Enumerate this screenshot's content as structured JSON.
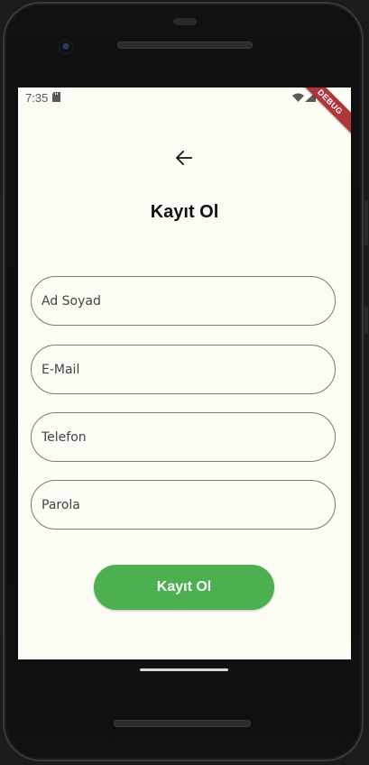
{
  "status_bar": {
    "time": "7:35",
    "sd_card_icon": "sd-card-icon",
    "wifi_icon": "wifi-icon",
    "signal_icon": "cell-signal-icon",
    "battery_icon": "battery-icon"
  },
  "debug_banner": {
    "label": "DEBUG",
    "color": "#b0353a"
  },
  "header": {
    "back_icon": "arrow-left-icon",
    "title": "Kayıt Ol"
  },
  "form": {
    "fields": [
      {
        "name": "ad-soyad",
        "placeholder": "Ad Soyad",
        "value": ""
      },
      {
        "name": "email",
        "placeholder": "E-Mail",
        "value": ""
      },
      {
        "name": "telefon",
        "placeholder": "Telefon",
        "value": ""
      },
      {
        "name": "parola",
        "placeholder": "Parola",
        "value": ""
      }
    ],
    "submit_label": "Kayıt Ol",
    "submit_color": "#4caf50"
  },
  "colors": {
    "screen_background": "#fbfcf4",
    "field_border": "#7a7a7a"
  }
}
